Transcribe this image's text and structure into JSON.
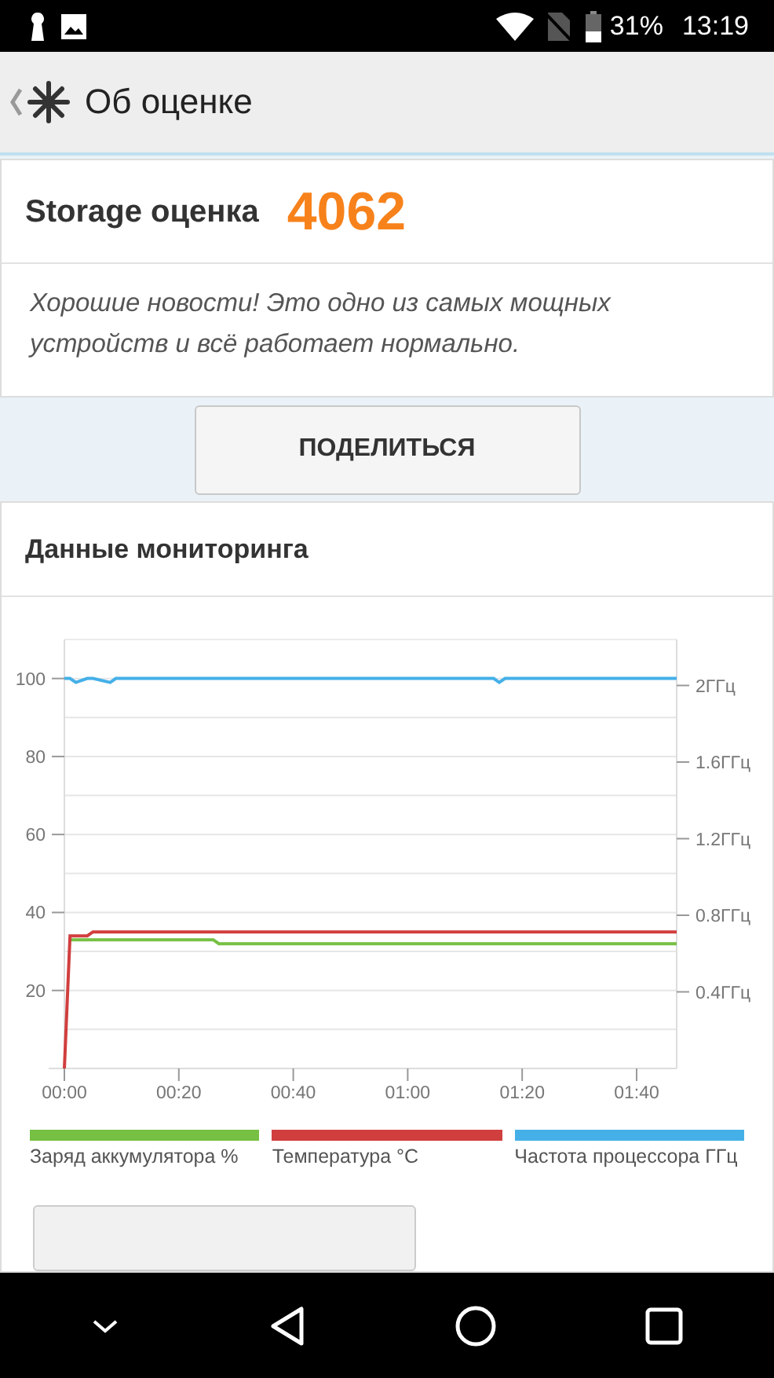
{
  "status_bar": {
    "battery": "31%",
    "time": "13:19"
  },
  "app_bar": {
    "title": "Об оценке"
  },
  "score_card": {
    "label": "Storage оценка",
    "score": "4062",
    "message": "Хорошие новости! Это одно из самых мощных устройств и всё работает нормально."
  },
  "share_button": "ПОДЕЛИТЬСЯ",
  "monitoring": {
    "title": "Данные мониторинга",
    "chart_data": {
      "type": "line",
      "grid": true,
      "x": [
        0,
        1,
        2,
        4,
        5,
        8,
        9,
        26,
        27,
        75,
        76,
        77,
        107
      ],
      "xlim": [
        0,
        107
      ],
      "ylim": [
        0,
        110
      ],
      "xticks": [
        {
          "value": 0,
          "label": "00:00"
        },
        {
          "value": 20,
          "label": "00:20"
        },
        {
          "value": 40,
          "label": "00:40"
        },
        {
          "value": 60,
          "label": "01:00"
        },
        {
          "value": 80,
          "label": "01:20"
        },
        {
          "value": 100,
          "label": "01:40"
        }
      ],
      "yticks": [
        20,
        40,
        60,
        80,
        100
      ],
      "y2lim": [
        0,
        2.24
      ],
      "y2ticks": [
        {
          "value": 0.4,
          "label": "0.4ГГц"
        },
        {
          "value": 0.8,
          "label": "0.8ГГц"
        },
        {
          "value": 1.2,
          "label": "1.2ГГц"
        },
        {
          "value": 1.6,
          "label": "1.6ГГц"
        },
        {
          "value": 2,
          "label": "2ГГц"
        }
      ],
      "series": [
        {
          "name": "Заряд аккумулятора %",
          "color": "#76c043",
          "values": [
            null,
            33,
            33,
            33,
            33,
            33,
            33,
            33,
            32,
            32,
            32,
            32,
            32
          ]
        },
        {
          "name": "Температура °C",
          "color": "#d13e3e",
          "values": [
            0,
            34,
            34,
            34,
            35,
            35,
            35,
            35,
            35,
            35,
            35,
            35,
            35
          ]
        },
        {
          "name": "Частота процессора ГГц",
          "color": "#45b0e8",
          "values": [
            100,
            100,
            99,
            100,
            100,
            99,
            100,
            100,
            100,
            100,
            99,
            100,
            100
          ]
        }
      ]
    }
  }
}
